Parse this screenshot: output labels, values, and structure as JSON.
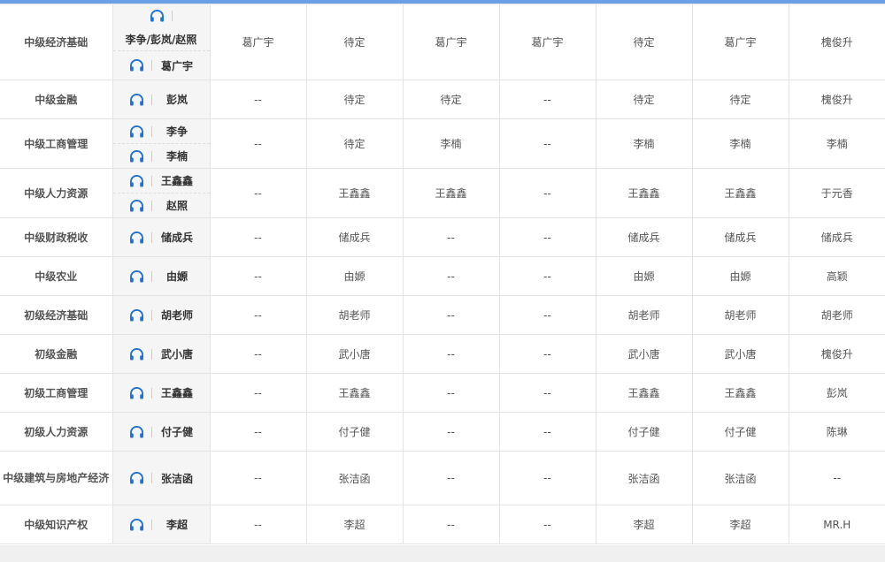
{
  "colors": {
    "accent": "#6aa0e6",
    "icon": "#1f6fd6",
    "teacher_bg": "#f5f5f5",
    "border": "#e4e4e4",
    "footer": "#f0f0f0"
  },
  "icon_name": "headphone-icon",
  "rows": [
    {
      "subject": "中级经济基础",
      "teachers_top": "李争/彭岚/赵照",
      "teachers": [
        "葛广宇"
      ],
      "cells": [
        "葛广宇",
        "待定",
        "葛广宇",
        "葛广宇",
        "待定",
        "葛广宇",
        "槐俊升"
      ]
    },
    {
      "subject": "中级金融",
      "teachers": [
        "彭岚"
      ],
      "cells": [
        "--",
        "待定",
        "待定",
        "--",
        "待定",
        "待定",
        "槐俊升"
      ]
    },
    {
      "subject": "中级工商管理",
      "teachers": [
        "李争",
        "李楠"
      ],
      "cells": [
        "--",
        "待定",
        "李楠",
        "--",
        "李楠",
        "李楠",
        "李楠"
      ]
    },
    {
      "subject": "中级人力资源",
      "teachers": [
        "王鑫鑫",
        "赵照"
      ],
      "cells": [
        "--",
        "王鑫鑫",
        "王鑫鑫",
        "--",
        "王鑫鑫",
        "王鑫鑫",
        "于元香"
      ]
    },
    {
      "subject": "中级财政税收",
      "teachers": [
        "储成兵"
      ],
      "cells": [
        "--",
        "储成兵",
        "--",
        "--",
        "储成兵",
        "储成兵",
        "储成兵"
      ]
    },
    {
      "subject": "中级农业",
      "teachers": [
        "由嫄"
      ],
      "cells": [
        "--",
        "由嫄",
        "--",
        "--",
        "由嫄",
        "由嫄",
        "高颖"
      ]
    },
    {
      "subject": "初级经济基础",
      "teachers": [
        "胡老师"
      ],
      "cells": [
        "--",
        "胡老师",
        "--",
        "--",
        "胡老师",
        "胡老师",
        "胡老师"
      ]
    },
    {
      "subject": "初级金融",
      "teachers": [
        "武小唐"
      ],
      "cells": [
        "--",
        "武小唐",
        "--",
        "--",
        "武小唐",
        "武小唐",
        "槐俊升"
      ]
    },
    {
      "subject": "初级工商管理",
      "teachers": [
        "王鑫鑫"
      ],
      "cells": [
        "--",
        "王鑫鑫",
        "--",
        "--",
        "王鑫鑫",
        "王鑫鑫",
        "彭岚"
      ]
    },
    {
      "subject": "初级人力资源",
      "teachers": [
        "付子健"
      ],
      "cells": [
        "--",
        "付子健",
        "--",
        "--",
        "付子健",
        "付子健",
        "陈琳"
      ]
    },
    {
      "subject": "中级建筑与房地产经济",
      "teachers": [
        "张洁函"
      ],
      "cells": [
        "--",
        "张洁函",
        "--",
        "--",
        "张洁函",
        "张洁函",
        "--"
      ]
    },
    {
      "subject": "中级知识产权",
      "teachers": [
        "李超"
      ],
      "cells": [
        "--",
        "李超",
        "--",
        "--",
        "李超",
        "李超",
        "MR.H"
      ]
    }
  ]
}
